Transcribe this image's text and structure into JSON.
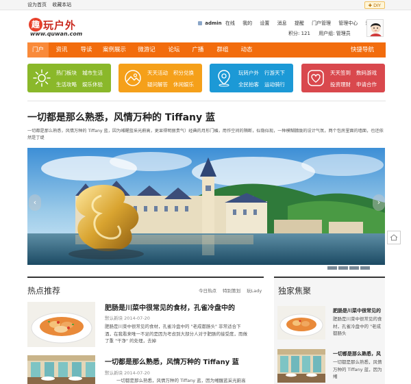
{
  "topbar": {
    "set_home": "设为首页",
    "bookmark": "收藏本站",
    "diy": "DIY"
  },
  "logo": {
    "mark": "趣",
    "name": "玩户外",
    "url": "www.quwan.com"
  },
  "user": {
    "name": "admin",
    "status": "在线",
    "menu": [
      "我的",
      "设置",
      "消息",
      "提醒",
      "门户管理",
      "管理中心",
      "退出"
    ],
    "points_label": "积分: 121",
    "group_label": "用户组: 管理员"
  },
  "nav": {
    "items": [
      "门户",
      "资讯",
      "导读",
      "案例展示",
      "微游记",
      "论坛",
      "广播",
      "群组",
      "动态"
    ],
    "quick": "快捷导航",
    "active_index": 0
  },
  "categories": [
    {
      "color": "#8ab82a",
      "icon": "sun-icon",
      "links": [
        "热门板块",
        "城市生活",
        "生活攻略",
        "娱乐休验"
      ]
    },
    {
      "color": "#f5a01a",
      "icon": "landscape-icon",
      "links": [
        "天天活动",
        "积分兑换",
        "疑问解答",
        "休闲娱乐"
      ]
    },
    {
      "color": "#1c99d6",
      "icon": "location-pin-icon",
      "links": [
        "玩转户外",
        "行游天下",
        "全民拍客",
        "运动骑行"
      ]
    },
    {
      "color": "#d9484d",
      "icon": "heart-icon",
      "links": [
        "天天签到",
        "数码游戏",
        "投资理财",
        "申请合作"
      ]
    }
  ],
  "article": {
    "title": "一切都是那么熟悉，风情万种的 Tiffany 蓝",
    "summary": "一切都是那么熟悉，风情万种的 Tiffany 蓝，因为缃醒蓝采光蔚高，更显得明丽贵气）经典的月形门楣，用作空间的隔断，似隐似现，一种模糊朦胧的设计气氛，两个包房里面的墙面，也还依然是丁缇"
  },
  "slider": {
    "dots": 5,
    "active_dot": 0,
    "prev": "‹",
    "next": "›"
  },
  "hot": {
    "title": "热点推荐",
    "tabs": [
      "今日热点",
      "特别策划",
      "玩Lady"
    ],
    "posts": [
      {
        "title": "肥肠是川菜中很常见的食材，孔雀冷盘中的",
        "date": "默认新块  2014-07-20",
        "excerpt": "肥肠是川菜中很常见的食材，孔雀冷盘中的 \"老成都肠头\" 非常适合下酒，在我看来唯一不足的是因为考虑到大部分人对于肥肠的接受度，而做了重 \"干净\" 的处理，去掉"
      },
      {
        "title": "一切都是那么熟悉，风情万种的 Tiffany 蓝",
        "date": "默认新块  2014-07-20",
        "excerpt": "一切都是那么熟悉，风情万种的 Tiffany 蓝，因为缃醒蓝采光蔚高"
      }
    ]
  },
  "exclusive": {
    "title": "独家焦聚",
    "items": [
      {
        "title": "肥肠是川菜中很常见的",
        "excerpt": "肥肠是川菜中很常见的食材，孔雀冷盘中的 \"老成都肠头"
      },
      {
        "title": "一切都是那么熟悉，风",
        "excerpt": "一切都是那么熟悉，风情万种的 Tiffany 蓝，因为缃"
      }
    ]
  }
}
